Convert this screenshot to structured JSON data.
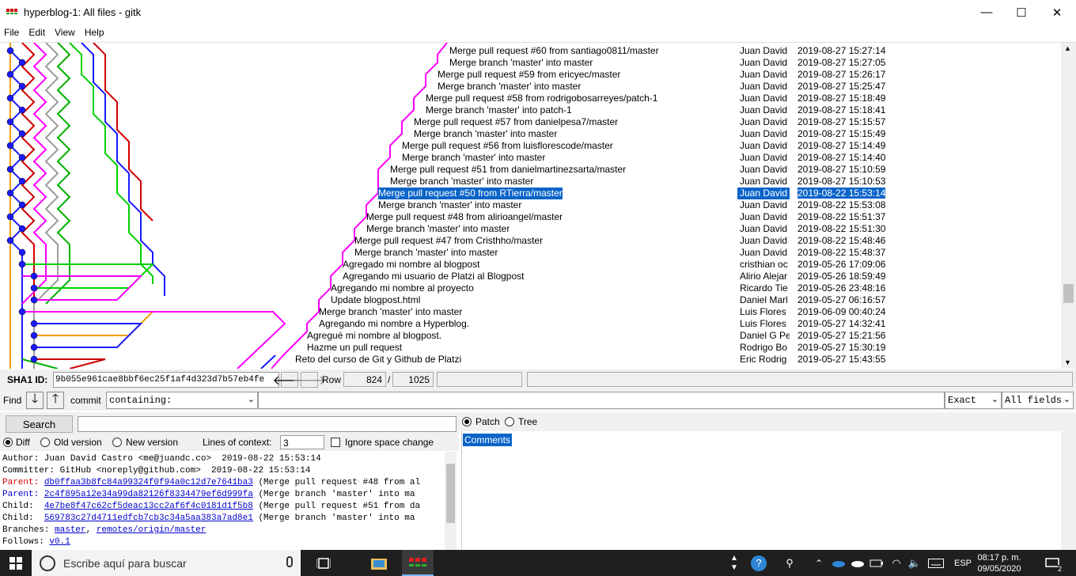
{
  "window": {
    "title": "hyperblog-1: All files - gitk",
    "minimize_glyph": "—",
    "maximize_glyph": "☐",
    "close_glyph": "✕"
  },
  "menu": {
    "items": [
      "File",
      "Edit",
      "View",
      "Help"
    ]
  },
  "history": {
    "commits": [
      {
        "message": "Merge pull request #60 from santiago0811/master",
        "author": "Juan David",
        "date": "2019-08-27 15:27:14"
      },
      {
        "message": "Merge branch 'master' into master",
        "author": "Juan David",
        "date": "2019-08-27 15:27:05"
      },
      {
        "message": "Merge pull request #59 from ericyec/master",
        "author": "Juan David",
        "date": "2019-08-27 15:26:17"
      },
      {
        "message": "Merge branch 'master' into master",
        "author": "Juan David",
        "date": "2019-08-27 15:25:47"
      },
      {
        "message": "Merge pull request #58 from rodrigobosarreyes/patch-1",
        "author": "Juan David",
        "date": "2019-08-27 15:18:49"
      },
      {
        "message": "Merge branch 'master' into patch-1",
        "author": "Juan David",
        "date": "2019-08-27 15:18:41"
      },
      {
        "message": "Merge pull request #57 from danielpesa7/master",
        "author": "Juan David",
        "date": "2019-08-27 15:15:57"
      },
      {
        "message": "Merge branch 'master' into master",
        "author": "Juan David",
        "date": "2019-08-27 15:15:49"
      },
      {
        "message": "Merge pull request #56 from luisflorescode/master",
        "author": "Juan David",
        "date": "2019-08-27 15:14:49"
      },
      {
        "message": "Merge branch 'master' into master",
        "author": "Juan David",
        "date": "2019-08-27 15:14:40"
      },
      {
        "message": "Merge pull request #51 from danielmartinezsarta/master",
        "author": "Juan David",
        "date": "2019-08-27 15:10:59"
      },
      {
        "message": "Merge branch 'master' into master",
        "author": "Juan David",
        "date": "2019-08-27 15:10:53"
      },
      {
        "message": "Merge pull request #50 from RTierra/master",
        "author": "Juan David",
        "date": "2019-08-22 15:53:14",
        "selected": true
      },
      {
        "message": "Merge branch 'master' into master",
        "author": "Juan David",
        "date": "2019-08-22 15:53:08"
      },
      {
        "message": "Merge pull request #48 from alirioangel/master",
        "author": "Juan David",
        "date": "2019-08-22 15:51:37"
      },
      {
        "message": "Merge branch 'master' into master",
        "author": "Juan David",
        "date": "2019-08-22 15:51:30"
      },
      {
        "message": "Merge pull request #47 from Cristhho/master",
        "author": "Juan David",
        "date": "2019-08-22 15:48:46"
      },
      {
        "message": "Merge branch 'master' into master",
        "author": "Juan David",
        "date": "2019-08-22 15:48:37"
      },
      {
        "message": "Agregado mi nombre al blogpost",
        "author": "cristhian oc",
        "date": "2019-05-26 17:09:06"
      },
      {
        "message": "Agregando mi usuario de Platzi al Blogpost",
        "author": "Alirio Alejar",
        "date": "2019-05-26 18:59:49"
      },
      {
        "message": "Agregando mi nombre al proyecto",
        "author": "Ricardo Tie",
        "date": "2019-05-26 23:48:16"
      },
      {
        "message": "Update blogpost.html",
        "author": "Daniel Marl",
        "date": "2019-05-27 06:16:57"
      },
      {
        "message": "Merge branch 'master' into master",
        "author": "Luis Flores",
        "date": "2019-06-09 00:40:24"
      },
      {
        "message": "Agregando mi nombre a Hyperblog.",
        "author": "Luis Flores",
        "date": "2019-05-27 14:32:41"
      },
      {
        "message": "Agregué mi nombre al blogpost.",
        "author": "Daniel G Pe",
        "date": "2019-05-27 15:21:56"
      },
      {
        "message": "Hazme un pull request",
        "author": "Rodrigo Bo",
        "date": "2019-05-27 15:30:19"
      },
      {
        "message": "Reto del curso de Git y Github de Platzi",
        "author": "Eric Rodrig",
        "date": "2019-05-27 15:43:55"
      }
    ]
  },
  "sha_bar": {
    "label": "SHA1 ID:",
    "value": "9b055e961cae8bbf6ec25f1af4d323d7b57eb4fe",
    "back_glyph": "🡐",
    "forward_glyph": "🡒",
    "row_label": "Row",
    "row_current": "824",
    "row_sep": "/",
    "row_total": "1025"
  },
  "find_bar": {
    "label": "Find",
    "down_glyph": "🡓",
    "up_glyph": "🡑",
    "commit_label": "commit",
    "mode_value": "containing:",
    "match_value": "Exact",
    "fields_value": "All fields",
    "caret": "⌄"
  },
  "search": {
    "button_label": "Search"
  },
  "diff_options": {
    "diff_label": "Diff",
    "old_label": "Old version",
    "new_label": "New version",
    "context_label": "Lines of context:",
    "context_value": "3",
    "ignore_label": "Ignore space change"
  },
  "details": {
    "author_line": "Author: Juan David Castro <me@juandc.co>  2019-08-22 15:53:14",
    "committer_line": "Committer: GitHub <noreply@github.com>  2019-08-22 15:53:14",
    "parents": [
      {
        "label": "Parent: ",
        "sha": "db0ffaa3b8fc84a99324f0f94a0c12d7e7641ba3",
        "desc": " (Merge pull request #48 from al",
        "red": true
      },
      {
        "label": "Parent: ",
        "sha": "2c4f895a12e34a99da82126f8334479ef6d999fa",
        "desc": " (Merge branch 'master' into ma",
        "red": false
      }
    ],
    "children": [
      {
        "label": "Child:  ",
        "sha": "4e7be8f47c62cf5deac13cc2af6f4c0181d1f5b8",
        "desc": " (Merge pull request #51 from da"
      },
      {
        "label": "Child:  ",
        "sha": "569783c27d4711edfcb7cb3c34a5aa383a7ad8e1",
        "desc": " (Merge branch 'master' into ma"
      }
    ],
    "branches_label": "Branches: ",
    "branch_1": "master",
    "branch_sep": ", ",
    "branch_2": "remotes/origin/master",
    "follows_label": "Follows: ",
    "follows_value": "v0.1"
  },
  "right_panel": {
    "patch_label": "Patch",
    "tree_label": "Tree",
    "comments_label": "Comments"
  },
  "taskbar": {
    "search_placeholder": "Escribe aquí para buscar",
    "language": "ESP",
    "time": "08:17 p. m.",
    "date": "09/05/2020",
    "notification_count": "2"
  }
}
